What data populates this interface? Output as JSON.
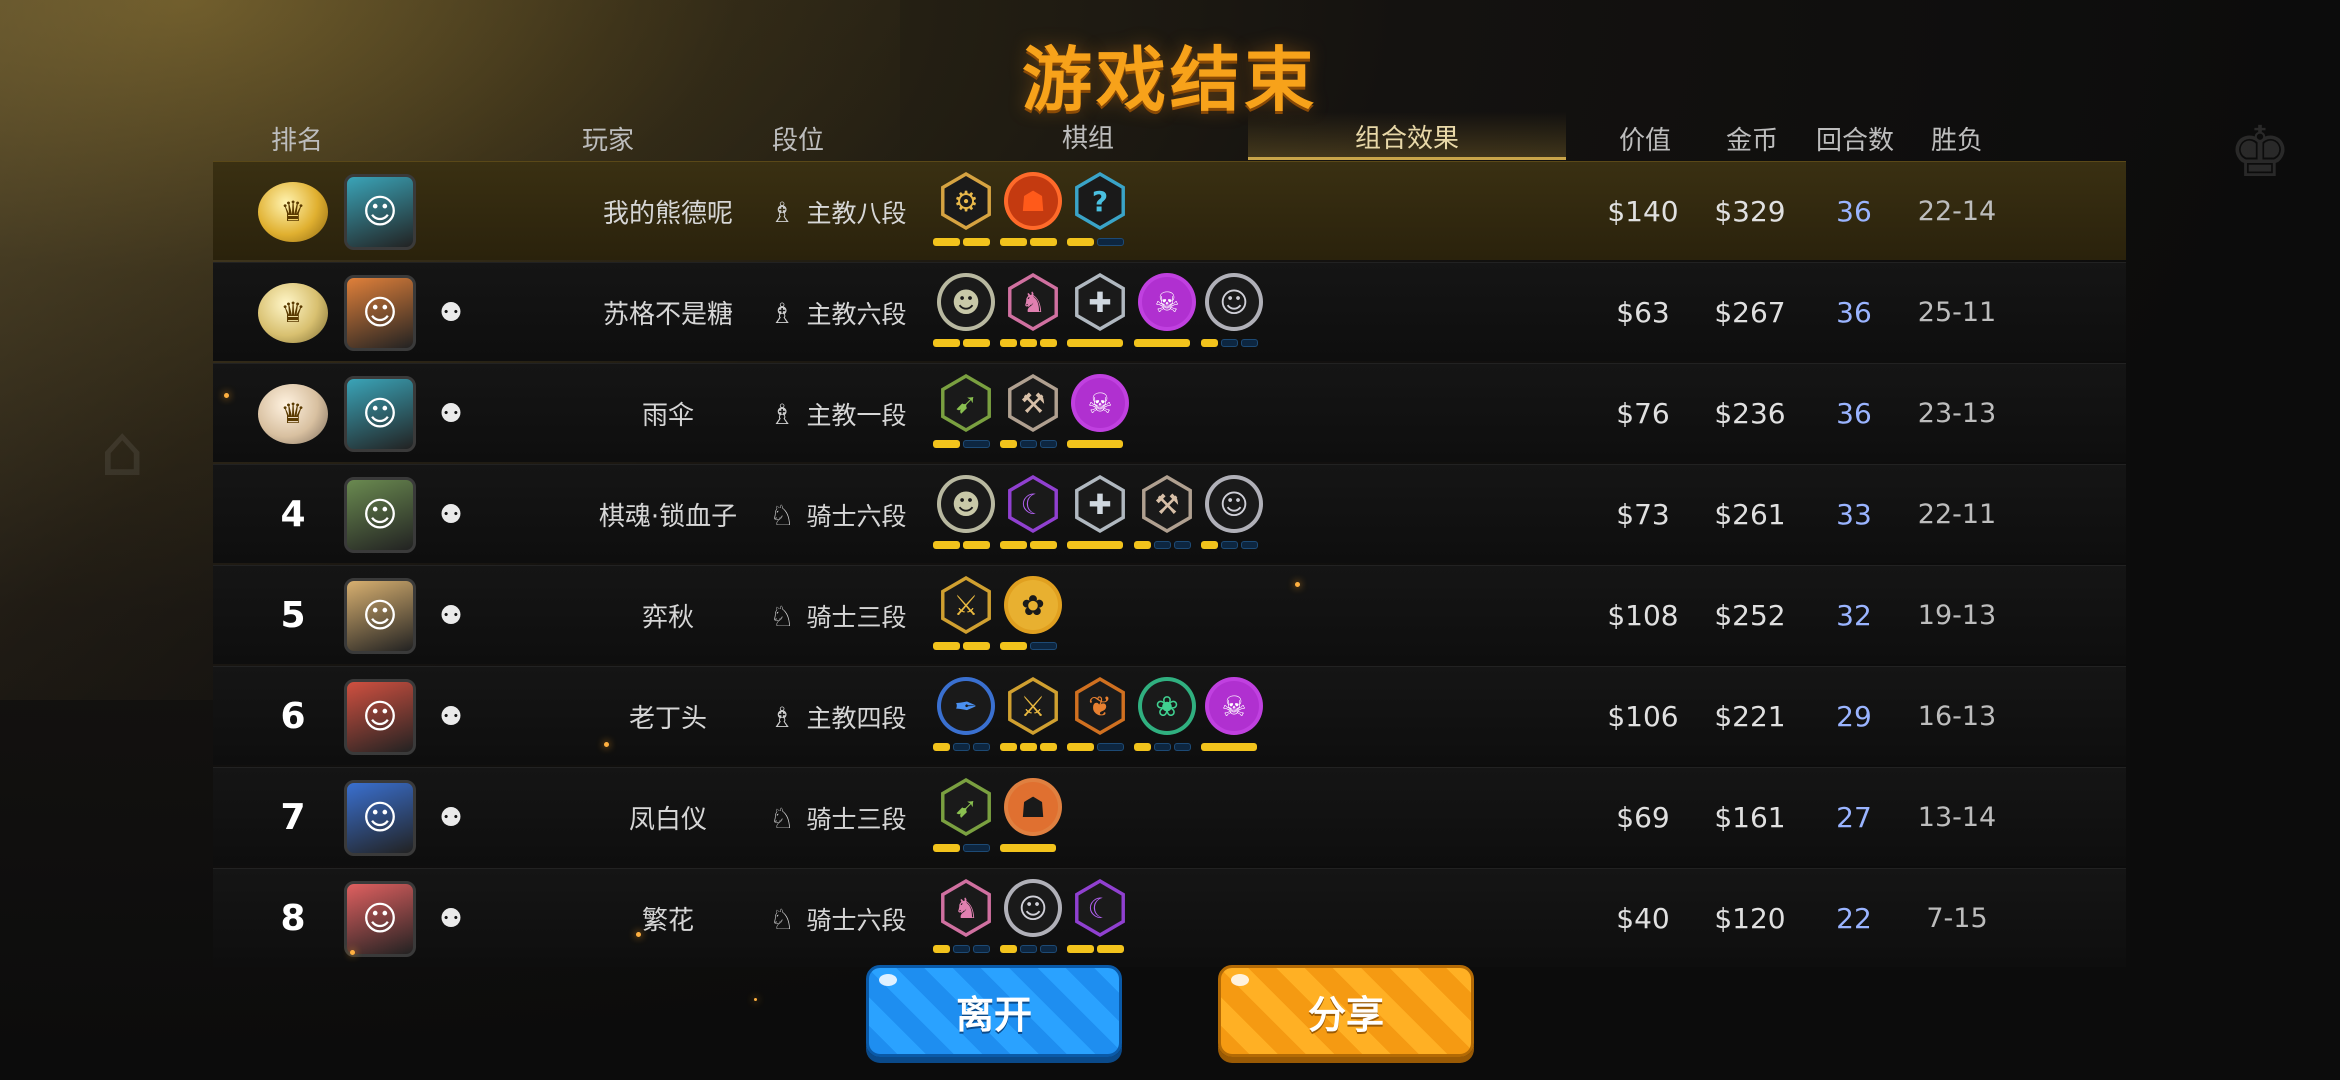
{
  "title": "游戏结束",
  "headers": {
    "rank": "排名",
    "player": "玩家",
    "tier": "段位",
    "pieces": "棋组",
    "synergy": "组合效果",
    "value": "价值",
    "gold": "金币",
    "rounds": "回合数",
    "win_loss": "胜负"
  },
  "colors": {
    "title": "#f7a21a",
    "pip_on": "#f2c31c",
    "pip_off": "#0d2640",
    "rounds": "#9ab4ff",
    "leave_button": "#2aa2ff",
    "share_button": "#ffb024"
  },
  "players": [
    {
      "rank": "1",
      "medal": "gold",
      "avatar_color": "#3aa4b8",
      "has_friend_icon": false,
      "name": "我的熊德呢",
      "tier_icon": "bishop-icon",
      "tier": "主教八段",
      "value": "$140",
      "gold": "$329",
      "rounds": "36",
      "win_loss": "22-14",
      "synergies": [
        {
          "icon": "gear-icon",
          "glyph": "⚙",
          "shape": "hex",
          "border": "#d6a341",
          "color": "#e8b84a"
        },
        {
          "icon": "demon-icon",
          "glyph": "☗",
          "shape": "circle",
          "border": "#ff6a2a",
          "color": "#ff5a1a",
          "fill": "#c43a10"
        },
        {
          "icon": "mystery-icon",
          "glyph": "?",
          "shape": "hex",
          "border": "#3aa4c8",
          "color": "#4ac0e0"
        }
      ],
      "pips": [
        [
          1,
          1
        ],
        [
          1,
          1
        ],
        [
          1,
          0
        ]
      ]
    },
    {
      "rank": "2",
      "medal": "silver",
      "avatar_color": "#e0803a",
      "has_friend_icon": true,
      "name": "苏格不是糖",
      "tier_icon": "bishop-icon",
      "tier": "主教六段",
      "value": "$63",
      "gold": "$267",
      "rounds": "36",
      "win_loss": "25-11",
      "synergies": [
        {
          "icon": "goblin-icon",
          "glyph": "☻",
          "shape": "circle",
          "border": "#b8b8a0",
          "color": "#c8c8a8"
        },
        {
          "icon": "knight-icon",
          "glyph": "♞",
          "shape": "hex",
          "border": "#d070a0",
          "color": "#e080b0"
        },
        {
          "icon": "cross-icon",
          "glyph": "✚",
          "shape": "hex",
          "border": "#b0b8c0",
          "color": "#d0d8e0"
        },
        {
          "icon": "skull-icon",
          "glyph": "☠",
          "shape": "circle",
          "border": "#c040e0",
          "color": "#ffffff",
          "fill": "#b030d0"
        },
        {
          "icon": "human-icon",
          "glyph": "☺",
          "shape": "circle",
          "border": "#b0b0b8",
          "color": "#d0d0d8"
        }
      ],
      "pips": [
        [
          1,
          1
        ],
        [
          1,
          1,
          1
        ],
        [
          1
        ],
        [
          1
        ],
        [
          1,
          0,
          0
        ]
      ]
    },
    {
      "rank": "3",
      "medal": "bronze",
      "avatar_color": "#3aa4b8",
      "has_friend_icon": true,
      "name": "雨伞",
      "tier_icon": "bishop-icon",
      "tier": "主教一段",
      "value": "$76",
      "gold": "$236",
      "rounds": "36",
      "win_loss": "23-13",
      "synergies": [
        {
          "icon": "bow-icon",
          "glyph": "➹",
          "shape": "hex",
          "border": "#7aa040",
          "color": "#8ac050"
        },
        {
          "icon": "axe-icon",
          "glyph": "⚒",
          "shape": "hex",
          "border": "#b0a090",
          "color": "#d8c0a8"
        },
        {
          "icon": "skull-icon",
          "glyph": "☠",
          "shape": "circle",
          "border": "#c040e0",
          "color": "#ffffff",
          "fill": "#b030d0"
        }
      ],
      "pips": [
        [
          1,
          0
        ],
        [
          1,
          0,
          0
        ],
        [
          1
        ]
      ]
    },
    {
      "rank": "4",
      "medal": "",
      "avatar_color": "#6a8a50",
      "has_friend_icon": true,
      "name": "棋魂·锁血子",
      "tier_icon": "knight-tier-icon",
      "tier": "骑士六段",
      "value": "$73",
      "gold": "$261",
      "rounds": "33",
      "win_loss": "22-11",
      "synergies": [
        {
          "icon": "goblin-icon",
          "glyph": "☻",
          "shape": "circle",
          "border": "#b8b8a0",
          "color": "#c8c8a8"
        },
        {
          "icon": "warlock-icon",
          "glyph": "☾",
          "shape": "hex",
          "border": "#9040d0",
          "color": "#b060f0"
        },
        {
          "icon": "cross-icon",
          "glyph": "✚",
          "shape": "hex",
          "border": "#b0b8c0",
          "color": "#d0d8e0"
        },
        {
          "icon": "axe-icon",
          "glyph": "⚒",
          "shape": "hex",
          "border": "#b0a090",
          "color": "#d8c0a8"
        },
        {
          "icon": "human-icon",
          "glyph": "☺",
          "shape": "circle",
          "border": "#b0b0b8",
          "color": "#d0d0d8"
        }
      ],
      "pips": [
        [
          1,
          1
        ],
        [
          1,
          1
        ],
        [
          1
        ],
        [
          1,
          0,
          0
        ],
        [
          1,
          0,
          0
        ]
      ]
    },
    {
      "rank": "5",
      "medal": "",
      "avatar_color": "#d8b070",
      "has_friend_icon": true,
      "name": "弈秋",
      "tier_icon": "knight-tier-icon",
      "tier": "骑士三段",
      "value": "$108",
      "gold": "$252",
      "rounds": "32",
      "win_loss": "19-13",
      "synergies": [
        {
          "icon": "assassin-icon",
          "glyph": "⚔",
          "shape": "hex",
          "border": "#d0a030",
          "color": "#e8b840"
        },
        {
          "icon": "insectoid-icon",
          "glyph": "✿",
          "shape": "circle",
          "border": "#e0a020",
          "color": "#1a1a1a",
          "fill": "#e8b030"
        }
      ],
      "pips": [
        [
          1,
          1
        ],
        [
          1,
          0
        ]
      ]
    },
    {
      "rank": "6",
      "medal": "",
      "avatar_color": "#d05040",
      "has_friend_icon": true,
      "name": "老丁头",
      "tier_icon": "bishop-icon",
      "tier": "主教四段",
      "value": "$106",
      "gold": "$221",
      "rounds": "29",
      "win_loss": "16-13",
      "synergies": [
        {
          "icon": "feather-icon",
          "glyph": "✒",
          "shape": "circle",
          "border": "#3a70d0",
          "color": "#4a90f0"
        },
        {
          "icon": "assassin-icon",
          "glyph": "⚔",
          "shape": "hex",
          "border": "#d0a030",
          "color": "#e8b840"
        },
        {
          "icon": "leaf-icon",
          "glyph": "❦",
          "shape": "hex",
          "border": "#d07020",
          "color": "#e88030"
        },
        {
          "icon": "paw-icon",
          "glyph": "❀",
          "shape": "circle",
          "border": "#30b080",
          "color": "#40d090"
        },
        {
          "icon": "skull-icon",
          "glyph": "☠",
          "shape": "circle",
          "border": "#c040e0",
          "color": "#ffffff",
          "fill": "#b030d0"
        }
      ],
      "pips": [
        [
          1,
          0,
          0
        ],
        [
          1,
          1,
          1
        ],
        [
          1,
          0
        ],
        [
          1,
          0,
          0
        ],
        [
          1
        ]
      ]
    },
    {
      "rank": "7",
      "medal": "",
      "avatar_color": "#3a70d0",
      "has_friend_icon": true,
      "name": "凤白仪",
      "tier_icon": "knight-tier-icon",
      "tier": "骑士三段",
      "value": "$69",
      "gold": "$161",
      "rounds": "27",
      "win_loss": "13-14",
      "synergies": [
        {
          "icon": "bow-icon",
          "glyph": "➹",
          "shape": "hex",
          "border": "#7aa040",
          "color": "#8ac050"
        },
        {
          "icon": "beast-icon",
          "glyph": "☗",
          "shape": "circle",
          "border": "#e08040",
          "color": "#1a1a1a",
          "fill": "#e07030"
        }
      ],
      "pips": [
        [
          1,
          0
        ],
        [
          1
        ]
      ]
    },
    {
      "rank": "8",
      "medal": "",
      "avatar_color": "#e06060",
      "has_friend_icon": true,
      "name": "繁花",
      "tier_icon": "knight-tier-icon",
      "tier": "骑士六段",
      "value": "$40",
      "gold": "$120",
      "rounds": "22",
      "win_loss": "7-15",
      "synergies": [
        {
          "icon": "knight-icon",
          "glyph": "♞",
          "shape": "hex",
          "border": "#d070a0",
          "color": "#e080b0"
        },
        {
          "icon": "human-icon",
          "glyph": "☺",
          "shape": "circle",
          "border": "#b0b0b8",
          "color": "#d0d0d8"
        },
        {
          "icon": "warlock-icon",
          "glyph": "☾",
          "shape": "hex",
          "border": "#9040d0",
          "color": "#b060f0"
        }
      ],
      "pips": [
        [
          1,
          0,
          0
        ],
        [
          1,
          0,
          0
        ],
        [
          1,
          1
        ]
      ]
    }
  ],
  "buttons": {
    "leave": "离开",
    "share": "分享"
  }
}
